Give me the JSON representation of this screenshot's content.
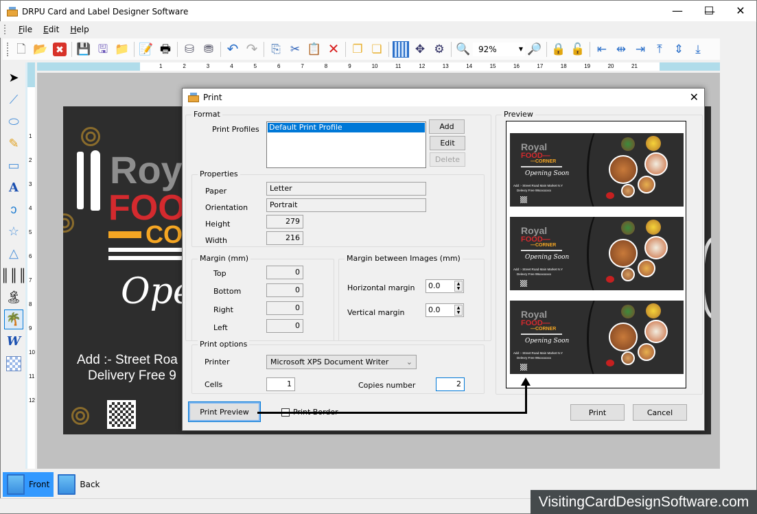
{
  "window": {
    "title": "DRPU Card and Label Designer Software",
    "controls": {
      "minimize": "—",
      "maximize": "☐",
      "close": "✕"
    }
  },
  "menubar": {
    "items": [
      {
        "label": "File",
        "accel": "F"
      },
      {
        "label": "Edit",
        "accel": "E"
      },
      {
        "label": "Help",
        "accel": "H"
      }
    ]
  },
  "toolbar": {
    "icons": [
      "new-file-icon",
      "open-folder-icon",
      "close-red-icon",
      "save-icon",
      "save-as-icon",
      "export-folder-icon",
      "edit-note-icon",
      "print-icon",
      "database-add-icon",
      "database-icon",
      "undo-icon",
      "redo-icon",
      "copy-icon",
      "cut-icon",
      "paste-icon",
      "delete-icon",
      "bring-front-icon",
      "send-back-icon",
      "grid-icon",
      "move-center-icon",
      "move-settings-icon",
      "zoom-in-icon",
      "zoom-out-icon",
      "lock-icon",
      "unlock-icon",
      "align-left-icon",
      "align-center-h-icon",
      "align-right-icon",
      "align-top-icon",
      "align-middle-v-icon",
      "align-bottom-icon"
    ],
    "zoom_value": "92%"
  },
  "left_tools": [
    "select-move-icon",
    "line-icon",
    "ellipse-icon",
    "pencil-icon",
    "rectangle-icon",
    "text-icon",
    "curve-icon",
    "star-icon",
    "triangle-icon",
    "barcode-icon",
    "image-icon",
    "image-library-icon",
    "word-art-icon",
    "watermark-icon"
  ],
  "ruler": {
    "h_ticks": [
      "1",
      "2",
      "3",
      "4",
      "5",
      "6",
      "7",
      "8",
      "9",
      "10",
      "11",
      "12",
      "13",
      "14",
      "15",
      "16",
      "17",
      "18",
      "19",
      "20",
      "21"
    ],
    "v_ticks": [
      "1",
      "2",
      "3",
      "4",
      "5",
      "6",
      "7",
      "8",
      "9",
      "10",
      "11",
      "12"
    ]
  },
  "card": {
    "royal": "Roy",
    "food": "FOO",
    "corner": "CO",
    "script": "Openi",
    "address": "Add :- Street Roa",
    "delivery": "Delivery Free 9"
  },
  "print_dialog": {
    "title": "Print",
    "format": {
      "group_label": "Format",
      "profiles_label": "Print Profiles",
      "profiles": [
        "Default Print Profile"
      ],
      "selected_profile": "Default Print Profile",
      "add_label": "Add",
      "edit_label": "Edit",
      "delete_label": "Delete"
    },
    "properties": {
      "group_label": "Properties",
      "paper_label": "Paper",
      "paper": "Letter",
      "orientation_label": "Orientation",
      "orientation": "Portrait",
      "height_label": "Height",
      "height": "279",
      "width_label": "Width",
      "width": "216"
    },
    "margin": {
      "group_label": "Margin (mm)",
      "top_label": "Top",
      "top": "0",
      "bottom_label": "Bottom",
      "bottom": "0",
      "right_label": "Right",
      "right": "0",
      "left_label": "Left",
      "left": "0"
    },
    "margin_between": {
      "group_label": "Margin between Images (mm)",
      "horizontal_label": "Horizontal margin",
      "horizontal": "0.0",
      "vertical_label": "Vertical margin",
      "vertical": "0.0"
    },
    "print_options": {
      "group_label": "Print options",
      "printer_label": "Printer",
      "printer": "Microsoft XPS Document Writer",
      "cells_label": "Cells",
      "cells": "1",
      "copies_label": "Copies number",
      "copies": "2"
    },
    "preview": {
      "group_label": "Preview",
      "card_copies": 3,
      "mini_card": {
        "royal": "Royal",
        "food": "FOOD—",
        "corner": "—CORNER",
        "opening": "Opening Soon",
        "address": "Add :- Street Road Main Market  N.Y",
        "delivery": "Delevry Free 99xxxxxxxx"
      }
    },
    "print_preview_label": "Print Preview",
    "print_border_label": "Print Border",
    "print_border_checked": false,
    "print_label": "Print",
    "cancel_label": "Cancel"
  },
  "bottom_tabs": [
    {
      "label": "Front",
      "active": true
    },
    {
      "label": "Back",
      "active": false
    }
  ],
  "watermark": "VisitingCardDesignSoftware.com"
}
